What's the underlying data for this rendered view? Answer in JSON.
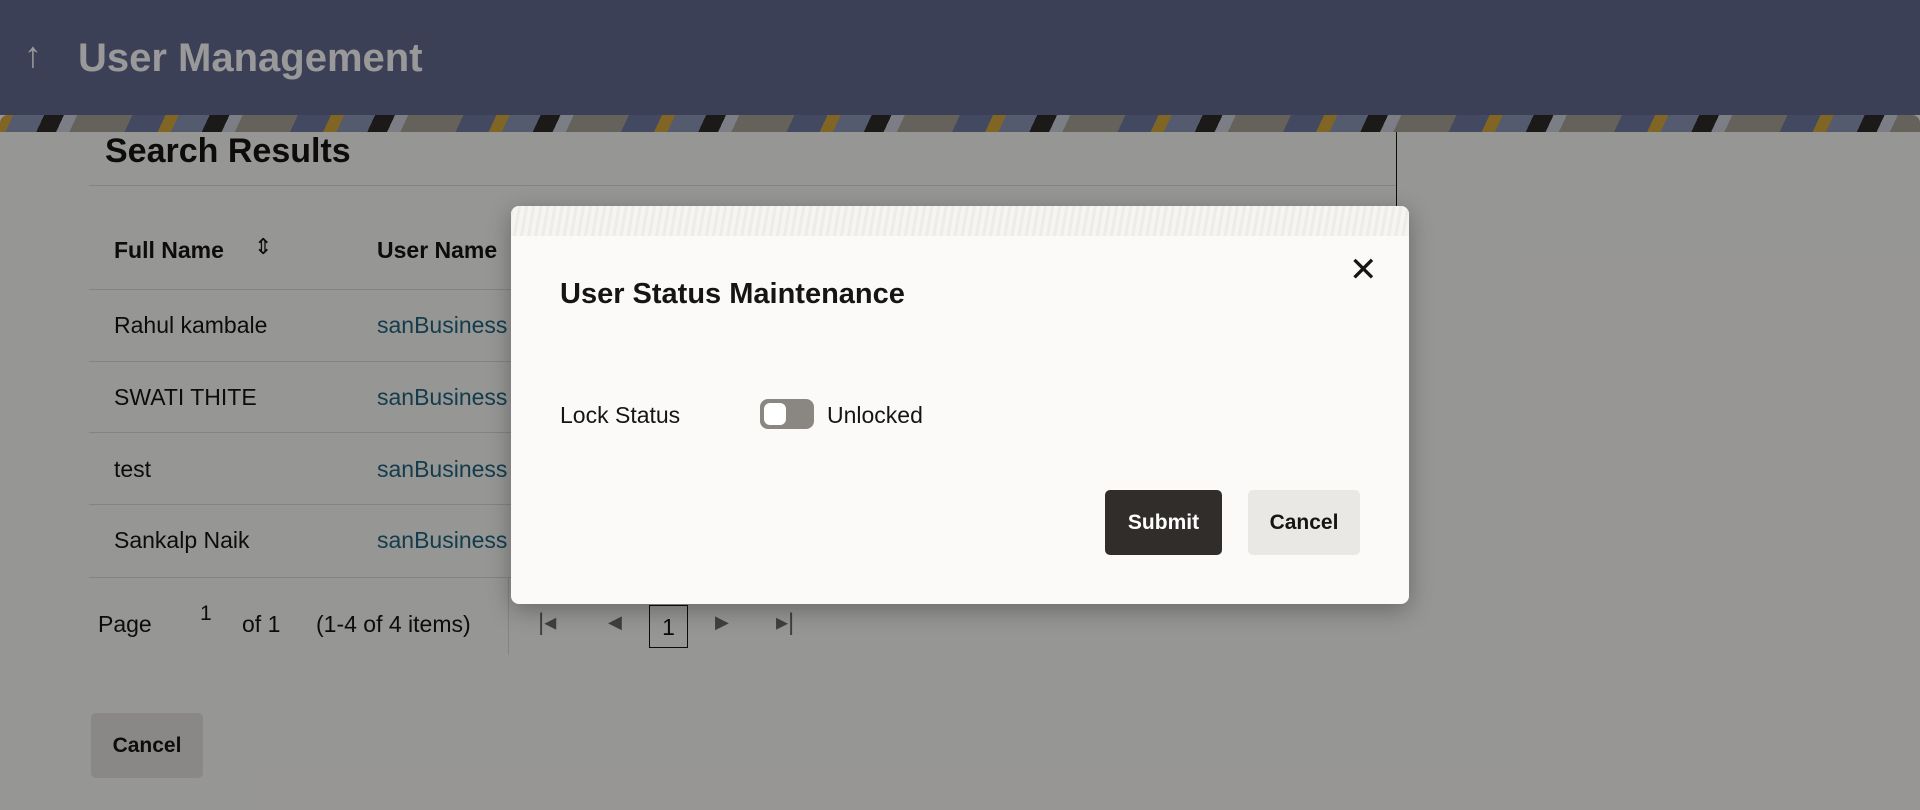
{
  "header": {
    "title": "User Management",
    "back_icon": "arrow-up-icon"
  },
  "results": {
    "title": "Search Results",
    "columns": [
      "Full Name",
      "User Name"
    ],
    "rows": [
      {
        "full_name": "Rahul kambale",
        "user_name": "sanBusiness"
      },
      {
        "full_name": "SWATI THITE",
        "user_name": "sanBusiness"
      },
      {
        "full_name": "test",
        "user_name": "sanBusiness"
      },
      {
        "full_name": "Sankalp Naik",
        "user_name": "sanBusiness"
      }
    ],
    "pagination": {
      "page_label": "Page",
      "page": "1",
      "of": "of 1",
      "range": "(1-4 of 4 items)",
      "current": "1"
    },
    "cancel": "Cancel"
  },
  "dialog": {
    "title": "User Status Maintenance",
    "lock_label": "Lock Status",
    "lock_value": "Unlocked",
    "locked": false,
    "submit": "Submit",
    "cancel": "Cancel"
  }
}
